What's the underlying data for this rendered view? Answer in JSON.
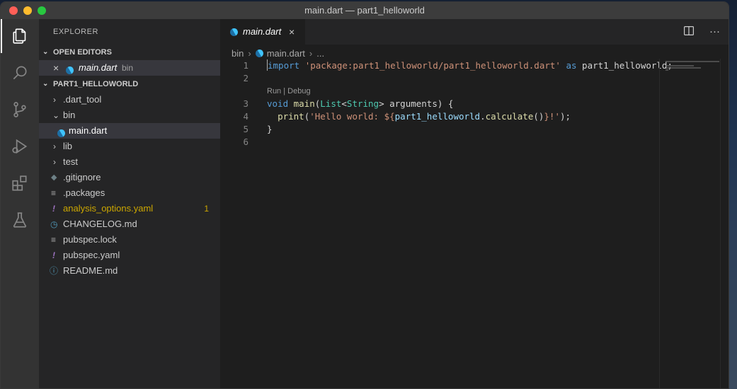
{
  "window": {
    "title": "main.dart — part1_helloworld"
  },
  "activity_bar": {
    "items": [
      "explorer-icon",
      "search-icon",
      "source-control-icon",
      "run-debug-icon",
      "extensions-icon",
      "testing-icon"
    ]
  },
  "sidebar": {
    "title": "EXPLORER",
    "open_editors": {
      "header": "OPEN EDITORS",
      "items": [
        {
          "close": "×",
          "name": "main.dart",
          "folder": "bin"
        }
      ]
    },
    "project": {
      "header": "PART1_HELLOWORLD",
      "items": [
        {
          "name": ".dart_tool",
          "type": "folder",
          "state": "collapsed"
        },
        {
          "name": "bin",
          "type": "folder",
          "state": "expanded"
        },
        {
          "name": "main.dart",
          "type": "dart"
        },
        {
          "name": "lib",
          "type": "folder",
          "state": "collapsed"
        },
        {
          "name": "test",
          "type": "folder",
          "state": "collapsed"
        },
        {
          "name": ".gitignore",
          "type": "git"
        },
        {
          "name": ".packages",
          "type": "lines"
        },
        {
          "name": "analysis_options.yaml",
          "type": "yaml",
          "badge": "1"
        },
        {
          "name": "CHANGELOG.md",
          "type": "clock"
        },
        {
          "name": "pubspec.lock",
          "type": "lines"
        },
        {
          "name": "pubspec.yaml",
          "type": "yaml"
        },
        {
          "name": "README.md",
          "type": "info"
        }
      ]
    }
  },
  "editor": {
    "tab": {
      "label": "main.dart",
      "close": "×"
    },
    "actions": {
      "split": "split-editor-icon",
      "more": "···"
    },
    "breadcrumb": {
      "folder": "bin",
      "file": "main.dart",
      "more": "..."
    },
    "codelens": "Run | Debug",
    "line_numbers": [
      "1",
      "2",
      "3",
      "4",
      "5",
      "6"
    ],
    "code": {
      "l1_kw": "import",
      "l1_str": "'package:part1_helloworld/part1_helloworld.dart'",
      "l1_as": "as",
      "l1_alias": "part1_helloworld;",
      "l3_void": "void",
      "l3_main": "main",
      "l3_p1": "(",
      "l3_list": "List",
      "l3_lt": "<",
      "l3_string": "String",
      "l3_rest": "> arguments) {",
      "l4_print": "print",
      "l4_p1": "(",
      "l4_str1": "'Hello world: ${",
      "l4_var": "part1_helloworld",
      "l4_dot": ".",
      "l4_calc": "calculate",
      "l4_call": "()",
      "l4_str2": "}!'",
      "l4_end": ");",
      "l5": "}"
    }
  }
}
